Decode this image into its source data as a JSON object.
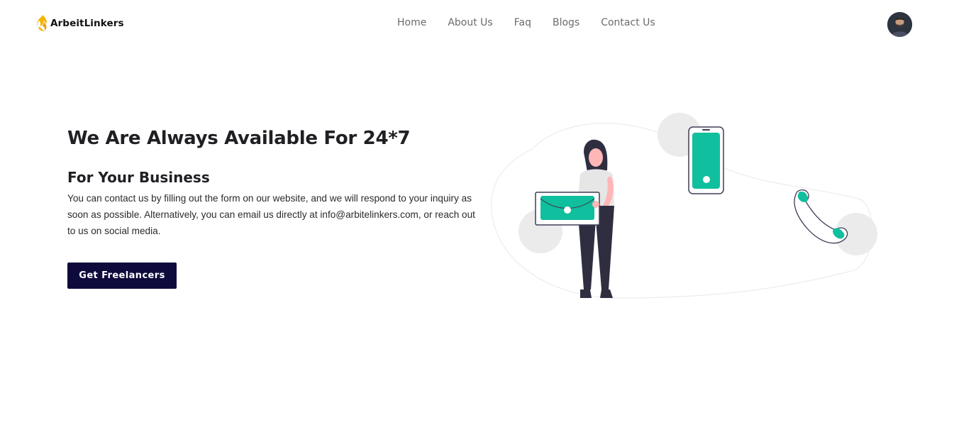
{
  "brand": {
    "name": "ArbeitLinkers"
  },
  "nav": {
    "items": [
      {
        "label": "Home"
      },
      {
        "label": "About Us"
      },
      {
        "label": "Faq"
      },
      {
        "label": "Blogs"
      },
      {
        "label": "Contact Us"
      }
    ]
  },
  "hero": {
    "title": "We Are Always Available For 24*7",
    "subtitle": "For Your Business",
    "text": "You can contact us by filling out the form on our website, and we will respond to your inquiry as soon as possible. Alternatively, you can email us directly at info@arbitelinkers.com, or reach out to us on social media.",
    "cta_label": "Get Freelancers"
  },
  "icons": {
    "logo": "flame-logo-icon",
    "avatar": "user-avatar"
  },
  "colors": {
    "brand_navy": "#0e0b3c",
    "accent_teal": "#0fbf9d",
    "logo_yellow": "#f5b301",
    "nav_text": "#6b6b6b"
  }
}
